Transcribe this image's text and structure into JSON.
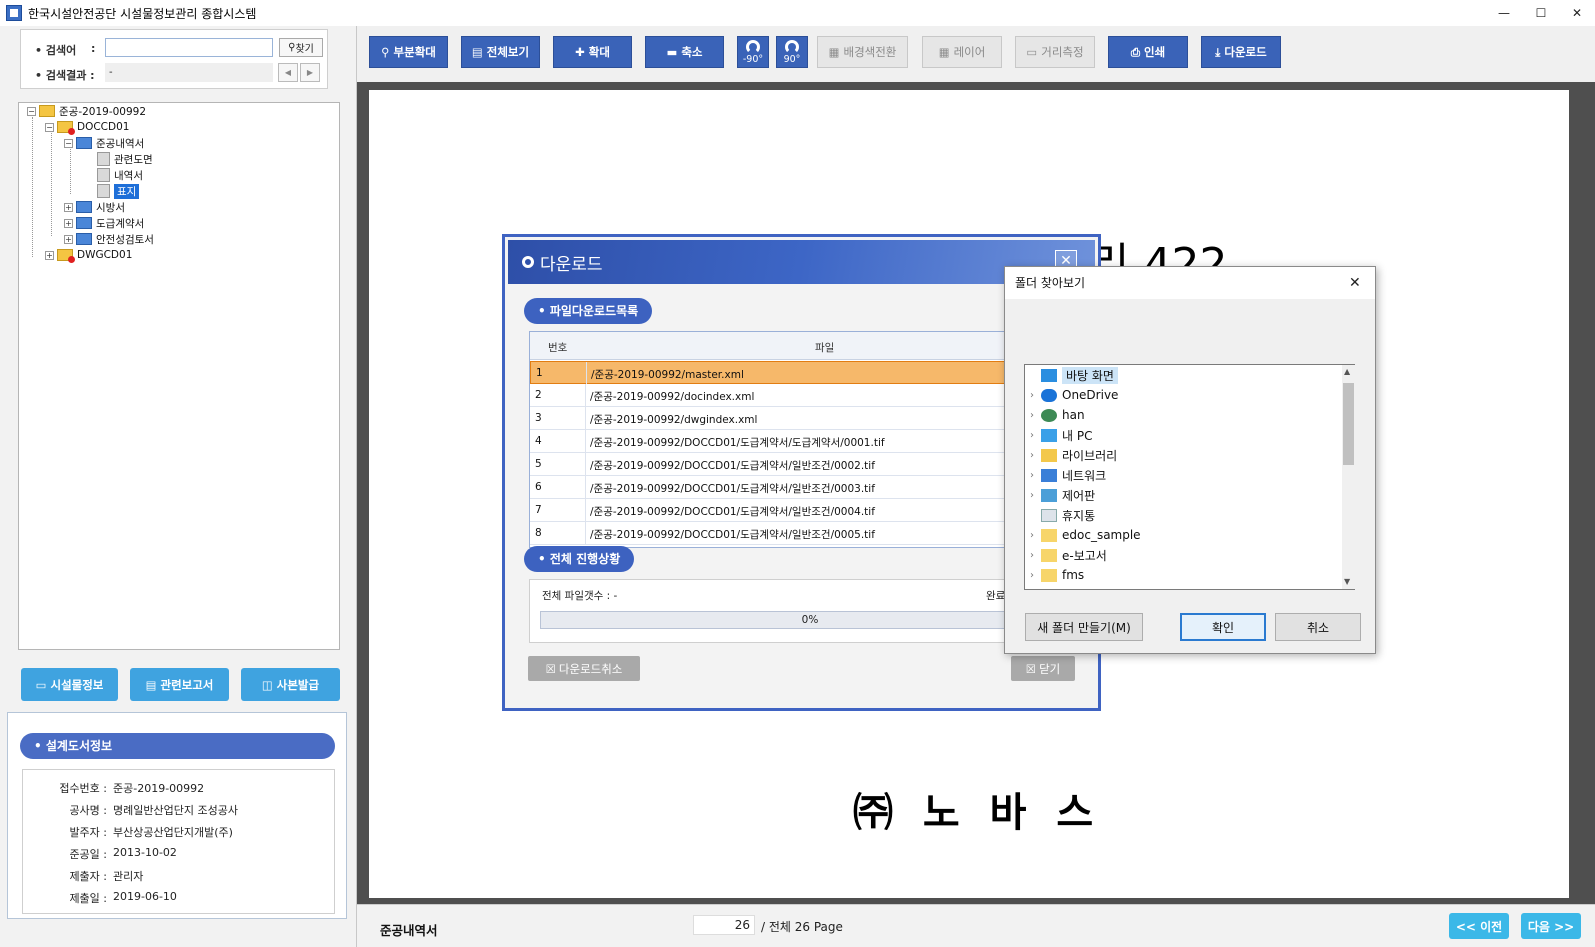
{
  "window": {
    "title": "한국시설안전공단 시설물정보관리 종합시스템",
    "minimize": "—",
    "maximize": "☐",
    "close": "✕"
  },
  "search": {
    "keyword_label": "• 검색어",
    "colon": ":",
    "keyword_value": "",
    "find_button": "찾기",
    "result_label": "• 검색결과 :",
    "result_value": "-",
    "prev": "◀",
    "next": "▶"
  },
  "tree": {
    "root": "준공-2019-00992",
    "docc": "DOCCD01",
    "junggong": "준공내역서",
    "related_drawing": "관련도면",
    "statement": "내역서",
    "cover": "표지",
    "spec": "시방서",
    "contract": "도급계약서",
    "safety": "안전성검토서",
    "dwg": "DWGCD01"
  },
  "left_buttons": {
    "facility_info": "시설물정보",
    "related_report": "관련보고서",
    "copy_issue": "사본발급"
  },
  "design_info": {
    "header": "• 설계도서정보",
    "rows": [
      {
        "label": "접수번호 :",
        "value": "준공-2019-00992"
      },
      {
        "label": "공사명 :",
        "value": "명례일반산업단지 조성공사"
      },
      {
        "label": "발주자 :",
        "value": "부산상공산업단지개발(주)"
      },
      {
        "label": "준공일 :",
        "value": "2013-10-02"
      },
      {
        "label": "제출자 :",
        "value": "관리자"
      },
      {
        "label": "제출일 :",
        "value": "2019-06-10"
      }
    ]
  },
  "toolbar": {
    "partial_zoom": "부분확대",
    "full_view": "전체보기",
    "zoom_in": "확대",
    "zoom_out": "축소",
    "rotate_left": "-90°",
    "rotate_right": "90°",
    "bg_color": "배경색전환",
    "layer": "레이어",
    "measure": "거리측정",
    "print": "인쇄",
    "download": "다운로드"
  },
  "document": {
    "partial_text": "리 422",
    "company": "㈜ 노 바 스"
  },
  "status": {
    "doc_title": "준공내역서",
    "current_page": "26",
    "total_text": "/ 전체  26 Page",
    "prev": "<< 이전",
    "next": "다음 >>"
  },
  "download_dialog": {
    "title": "다운로드",
    "close": "✕",
    "list_label": "• 파일다운로드목록",
    "col_no": "번호",
    "col_file": "파일",
    "files": [
      {
        "no": "1",
        "path": "/준공-2019-00992/master.xml"
      },
      {
        "no": "2",
        "path": "/준공-2019-00992/docindex.xml"
      },
      {
        "no": "3",
        "path": "/준공-2019-00992/dwgindex.xml"
      },
      {
        "no": "4",
        "path": "/준공-2019-00992/DOCCD01/도급계약서/도급계약서/0001.tif"
      },
      {
        "no": "5",
        "path": "/준공-2019-00992/DOCCD01/도급계약서/일반조건/0002.tif"
      },
      {
        "no": "6",
        "path": "/준공-2019-00992/DOCCD01/도급계약서/일반조건/0003.tif"
      },
      {
        "no": "7",
        "path": "/준공-2019-00992/DOCCD01/도급계약서/일반조건/0004.tif"
      },
      {
        "no": "8",
        "path": "/준공-2019-00992/DOCCD01/도급계약서/일반조건/0005.tif"
      }
    ],
    "progress_label": "• 전체 진행상황",
    "file_count": "전체 파일갯수 : -",
    "complete": "완료",
    "progress": "0%",
    "cancel_download": "다운로드취소",
    "close_button": "닫기"
  },
  "folder_dialog": {
    "title": "폴더 찾아보기",
    "close": "✕",
    "items": [
      {
        "label": "바탕 화면"
      },
      {
        "label": "OneDrive"
      },
      {
        "label": "han"
      },
      {
        "label": "내 PC"
      },
      {
        "label": "라이브러리"
      },
      {
        "label": "네트워크"
      },
      {
        "label": "제어판"
      },
      {
        "label": "휴지통"
      },
      {
        "label": "edoc_sample"
      },
      {
        "label": "e-보고서"
      },
      {
        "label": "fms"
      }
    ],
    "new_folder": "새 폴더 만들기(M)",
    "ok": "확인",
    "cancel": "취소"
  }
}
